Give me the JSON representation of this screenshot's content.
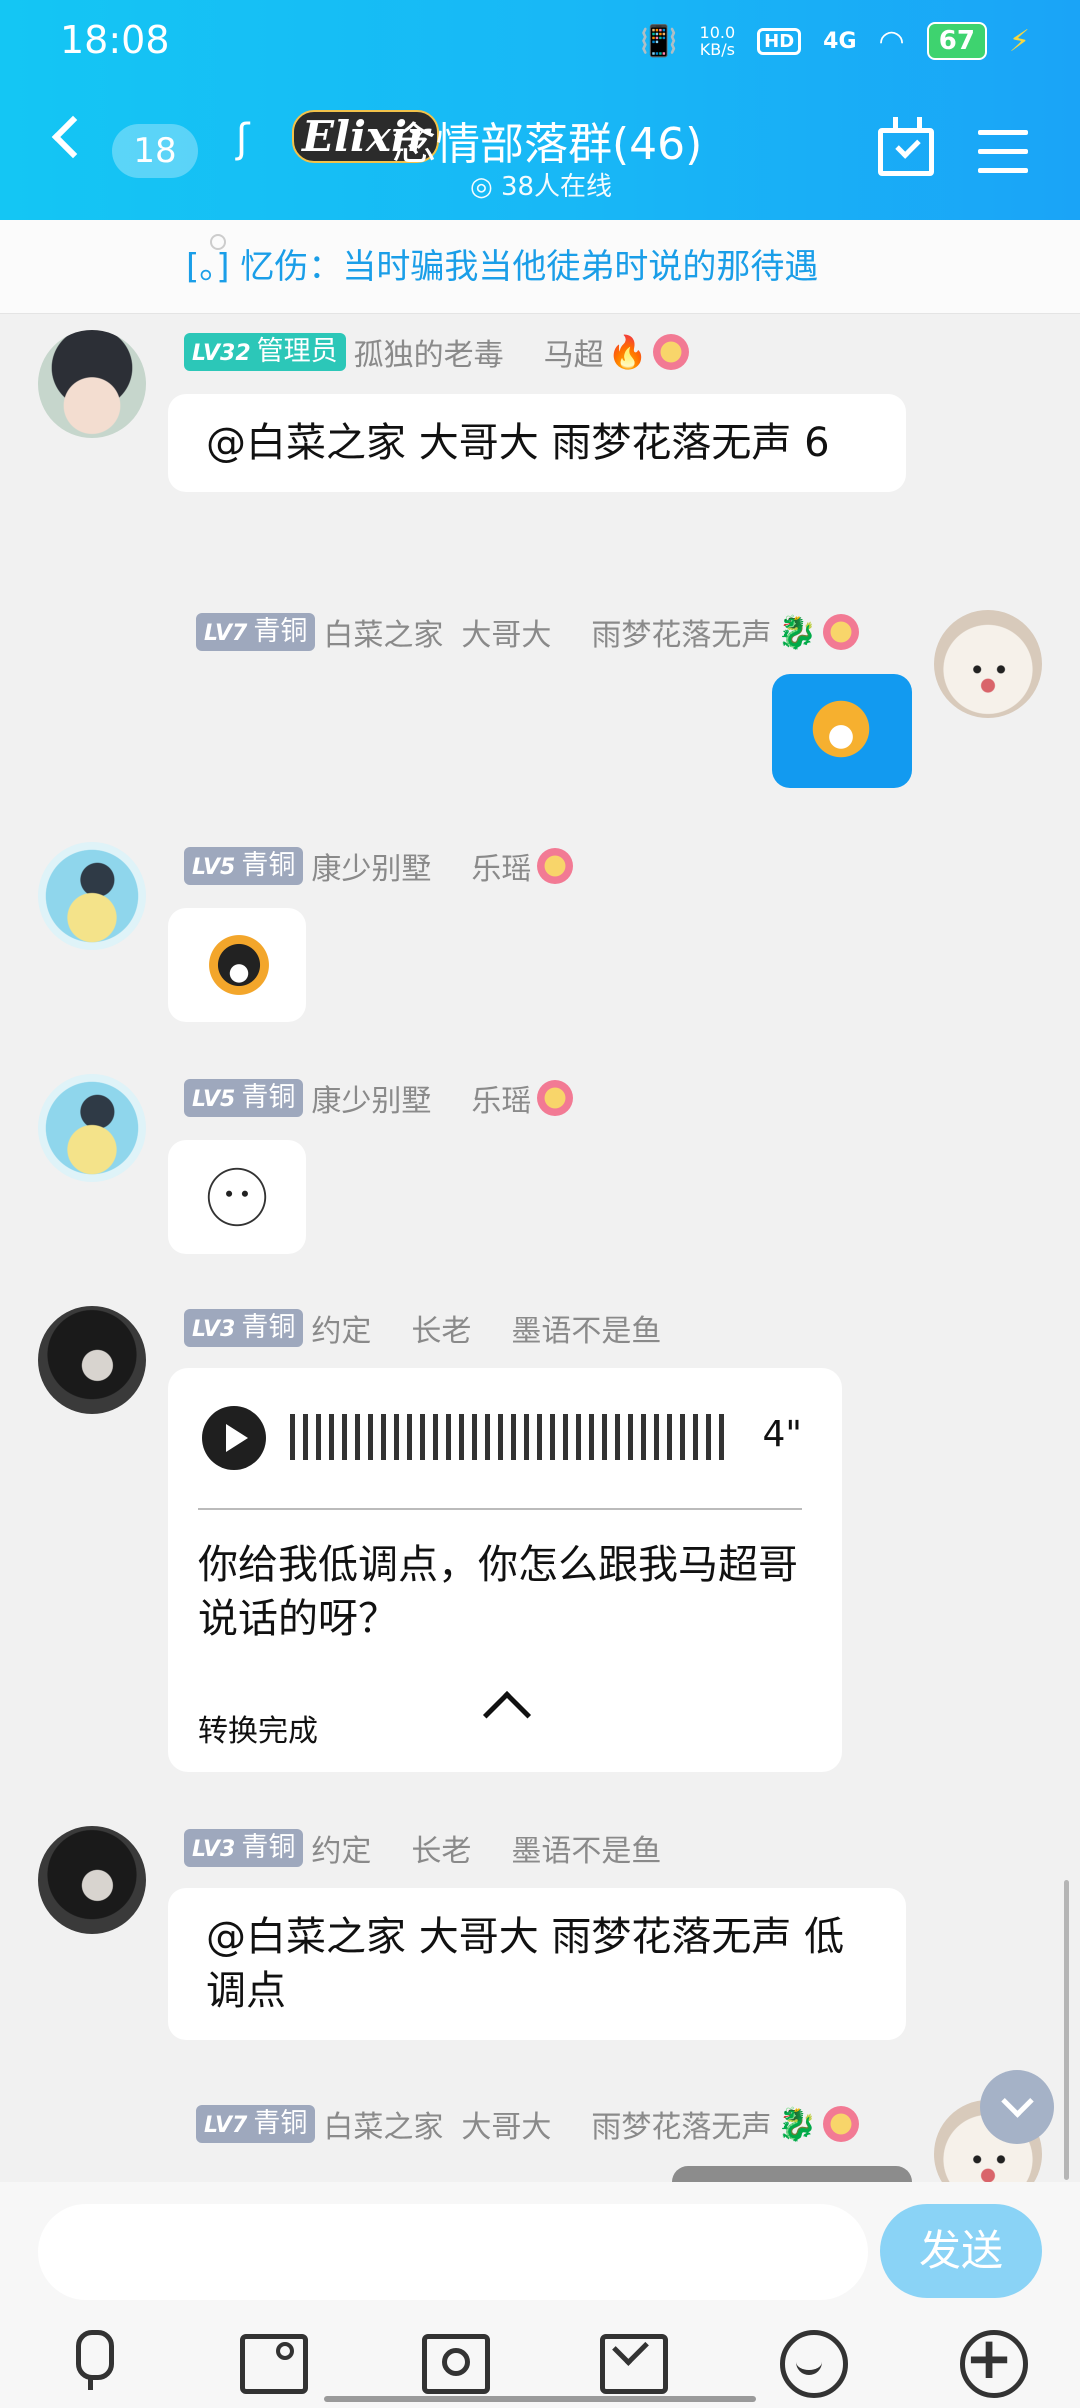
{
  "status_bar": {
    "time": "18:08",
    "net_speed_top": "10.0",
    "net_speed_unit": "KB/s",
    "hd": "HD",
    "signal": "4G",
    "battery": "67"
  },
  "header": {
    "unread_count": "18",
    "brand": "Elixir",
    "title": "念情部落群(46)",
    "online": "38人在线"
  },
  "notice": {
    "text": "[。] 忆伤：当时骗我当他徒弟时说的那待遇"
  },
  "messages": [
    {
      "level": "LV32",
      "rank": "管理员",
      "name1": "孤独的老毒",
      "name2": "马超",
      "text": "@白菜之家  大哥大    雨梦花落无声  6"
    },
    {
      "level": "LV7",
      "rank": "青铜",
      "name1": "白菜之家",
      "name2": "大哥大",
      "name3": "雨梦花落无声"
    },
    {
      "level": "LV5",
      "rank": "青铜",
      "name1": "康少别墅",
      "name2": "乐瑶"
    },
    {
      "level": "LV5",
      "rank": "青铜",
      "name1": "康少别墅",
      "name2": "乐瑶"
    },
    {
      "level": "LV3",
      "rank": "青铜",
      "name1": "约定",
      "name2": "长老",
      "name3": "墨语不是鱼",
      "voice_duration": "4\"",
      "voice_text": "你给我低调点，你怎么跟我马超哥说话的呀？",
      "voice_status": "转换完成"
    },
    {
      "level": "LV3",
      "rank": "青铜",
      "name1": "约定",
      "name2": "长老",
      "name3": "墨语不是鱼",
      "text": "@白菜之家  大哥大    雨梦花落无声  低调点"
    },
    {
      "level": "LV7",
      "rank": "青铜",
      "name1": "白菜之家",
      "name2": "大哥大",
      "name3": "雨梦花落无声"
    }
  ],
  "input": {
    "placeholder": "",
    "send_label": "发送"
  },
  "toolbar": [
    "mic-icon",
    "image-icon",
    "camera-icon",
    "red-packet-icon",
    "emoji-icon",
    "plus-icon"
  ]
}
